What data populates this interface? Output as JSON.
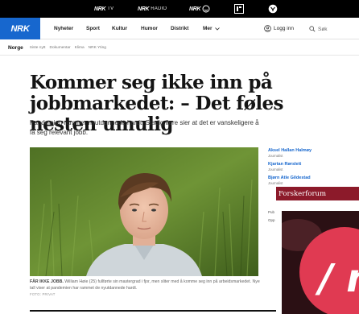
{
  "services": [
    {
      "logo": "NRK",
      "suffix": "TV"
    },
    {
      "logo": "NRK",
      "suffix": "RADIO"
    },
    {
      "logo": "NRK",
      "suffix": ""
    }
  ],
  "nav": {
    "logo": "NRK",
    "items": [
      "Nyheter",
      "Sport",
      "Kultur",
      "Humor",
      "Distrikt"
    ],
    "more": "Mer",
    "login": "Logg inn",
    "search_placeholder": "Søk"
  },
  "section": {
    "title": "Norge",
    "links": [
      "Siste nytt",
      "Dokumentar",
      "Klima",
      "NRK Yting"
    ]
  },
  "article": {
    "headline": "Kommer seg ikke inn på jobbmarkedet: – Det føles nesten umulig",
    "lead": "Pandemien rammer nyutdannede hardt. Stadig flere sier at det er vanskeligere å få seg relevant jobb.",
    "caption_lead": "FÅR IKKE JOBB.",
    "caption_text": "William Høie (25) fullførte sin mastergrad i fjor, men sliter med å komme seg inn på arbeidsmarkedet. Nye tall viser at pandemien har rammet de nyutdannede hardt.",
    "credit": "FOTO: PRIVAT"
  },
  "authors": [
    {
      "name": "Aksel Hallan Halmøy",
      "role": "Journalist"
    },
    {
      "name": "Kjartan Rørslett",
      "role": "Journalist"
    },
    {
      "name": "Bjørn Atle Gildestad",
      "role": "Journalist"
    }
  ],
  "publish": {
    "pub": "Pub",
    "opp": "Opp"
  },
  "ads": {
    "forskerforum": "Forskerforum",
    "big": "/ n"
  },
  "colors": {
    "brand_blue": "#1767ce",
    "topbar": "#000000",
    "ad_red": "#8c1a2a"
  }
}
